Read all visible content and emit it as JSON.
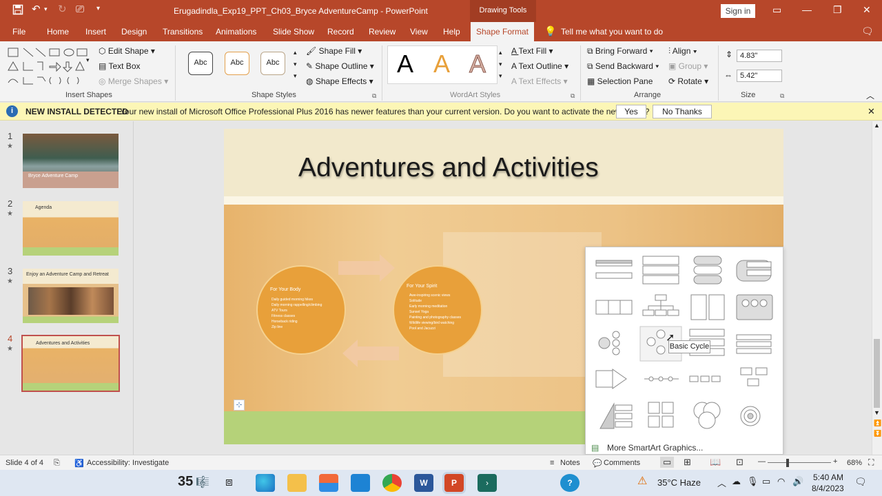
{
  "titlebar": {
    "doc_title": "Erugadindla_Exp19_PPT_Ch03_Bryce AdventureCamp  -  PowerPoint",
    "context_tab": "Drawing Tools",
    "signin": "Sign in"
  },
  "tabs": [
    "File",
    "Home",
    "Insert",
    "Design",
    "Transitions",
    "Animations",
    "Slide Show",
    "Record",
    "Review",
    "View",
    "Help"
  ],
  "active_tab": "Shape Format",
  "tell_me": "Tell me what you want to do",
  "ribbon": {
    "insert_shapes": {
      "edit_shape": "Edit Shape",
      "text_box": "Text Box",
      "merge_shapes": "Merge Shapes",
      "label": "Insert Shapes"
    },
    "shape_styles": {
      "samples": [
        "Abc",
        "Abc",
        "Abc"
      ],
      "fill": "Shape Fill",
      "outline": "Shape Outline",
      "effects": "Shape Effects",
      "label": "Shape Styles"
    },
    "wordart": {
      "samples": [
        "A",
        "A",
        "A"
      ],
      "text_fill": "Text Fill",
      "text_outline": "Text Outline",
      "text_effects": "Text Effects",
      "label": "WordArt Styles"
    },
    "arrange": {
      "bring_forward": "Bring Forward",
      "send_backward": "Send Backward",
      "selection_pane": "Selection Pane",
      "align": "Align",
      "group": "Group",
      "rotate": "Rotate",
      "label": "Arrange"
    },
    "size": {
      "height": "4.83\"",
      "width": "5.42\"",
      "label": "Size"
    }
  },
  "notification": {
    "title": "NEW INSTALL DETECTED",
    "message": "Your new install of Microsoft Office Professional Plus 2016 has newer features than your current version. Do you want to activate the new install?",
    "yes": "Yes",
    "no": "No Thanks"
  },
  "thumbnails": [
    {
      "num": "1",
      "title": "Bryce Adventure Camp"
    },
    {
      "num": "2",
      "title": "Agenda"
    },
    {
      "num": "3",
      "title": "Enjoy an Adventure Camp and Retreat"
    },
    {
      "num": "4",
      "title": "Adventures and Activities"
    }
  ],
  "slide": {
    "title": "Adventures and Activities",
    "left_circle": {
      "heading": "For Your Body",
      "items": [
        "Daily guided morning hikes",
        "Daily morning rappelling/climbing",
        "ATV Tours",
        "Fitness classes",
        "Horseback riding",
        "Zip line"
      ]
    },
    "right_circle": {
      "heading": "For Your Spirit",
      "items": [
        "Awe-inspiring scenic views",
        "Solitude",
        "Early morning meditation",
        "Sunset Yoga",
        "Painting and photography classes",
        "Wildlife viewing/bird watching",
        "Pool and Jacuzzi"
      ]
    }
  },
  "gallery": {
    "tooltip": "Basic Cycle",
    "more": "More SmartArt Graphics..."
  },
  "statusbar": {
    "slide": "Slide 4 of 4",
    "accessibility": "Accessibility: Investigate",
    "notes": "Notes",
    "comments": "Comments",
    "zoom": "68%"
  },
  "taskbar": {
    "weather_temp": "35",
    "weather": "35°C  Haze",
    "time": "5:40 AM",
    "date": "8/4/2023"
  }
}
